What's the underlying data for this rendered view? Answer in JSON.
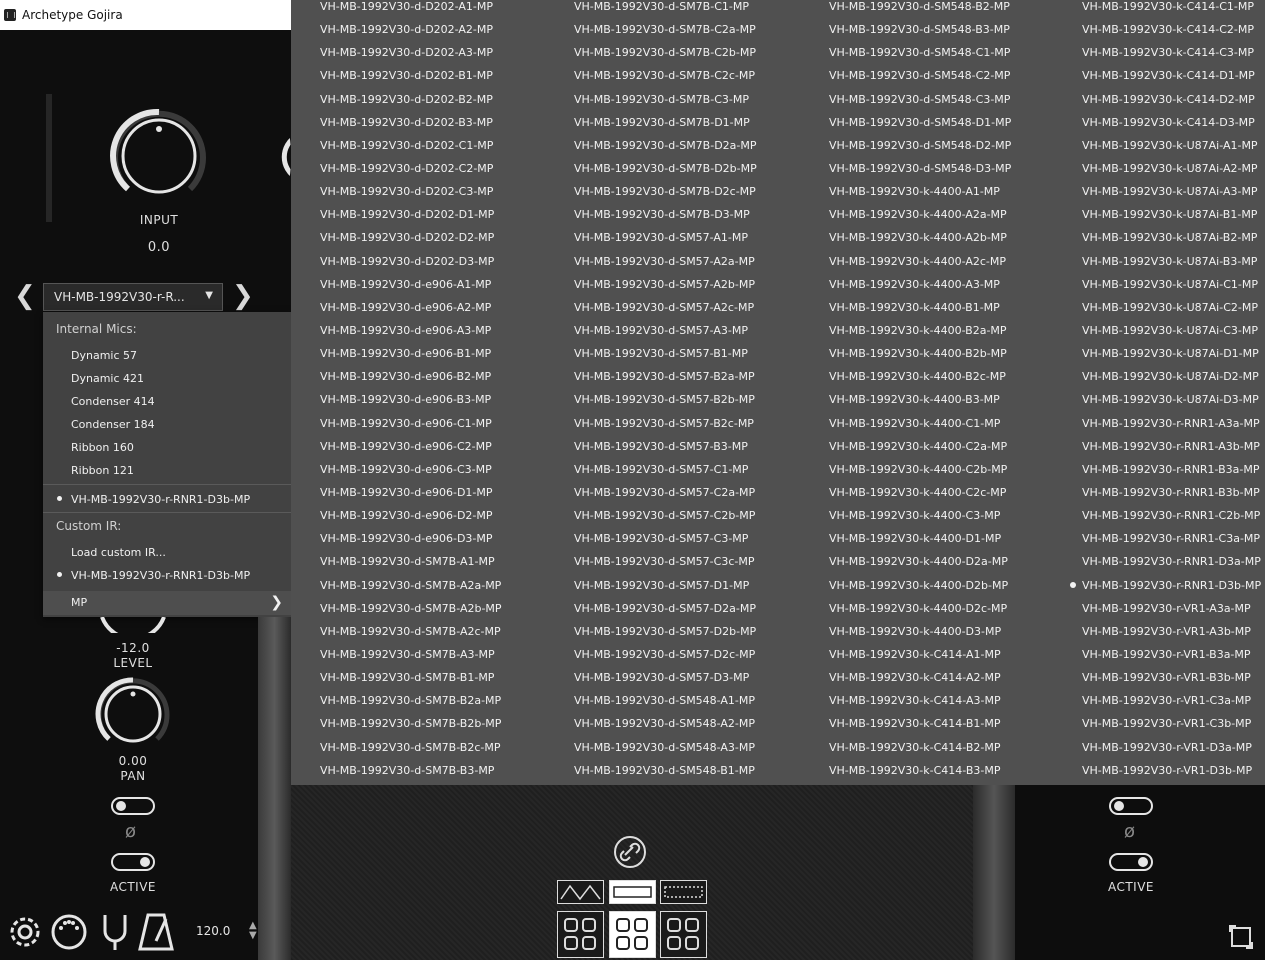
{
  "window": {
    "title": "Archetype Gojira"
  },
  "input": {
    "label": "INPUT",
    "value": "0.0"
  },
  "preset": {
    "current": "VH-MB-1992V30-r-R..."
  },
  "menu": {
    "internal_header": "Internal Mics:",
    "internal_items": [
      "Dynamic 57",
      "Dynamic 421",
      "Condenser 414",
      "Condenser 184",
      "Ribbon 160",
      "Ribbon 121"
    ],
    "selected_internal": "VH-MB-1992V30-r-RNR1-D3b-MP",
    "custom_header": "Custom IR:",
    "load_custom": "Load custom IR...",
    "selected_custom": "VH-MB-1992V30-r-RNR1-D3b-MP",
    "mp_label": "MP"
  },
  "mic": {
    "level_value": "-12.0",
    "level_label": "LEVEL",
    "pan_value": "0.00",
    "pan_label": "PAN",
    "active_label": "ACTIVE",
    "right_active_label": "ACTIVE"
  },
  "phase_symbol": "ø",
  "tempo": {
    "value": "120.0"
  },
  "submenu": {
    "selected": "VH-MB-1992V30-r-RNR1-D3b-MP",
    "columns": [
      [
        "VH-MB-1992V30-d-D202-A1-MP",
        "VH-MB-1992V30-d-D202-A2-MP",
        "VH-MB-1992V30-d-D202-A3-MP",
        "VH-MB-1992V30-d-D202-B1-MP",
        "VH-MB-1992V30-d-D202-B2-MP",
        "VH-MB-1992V30-d-D202-B3-MP",
        "VH-MB-1992V30-d-D202-C1-MP",
        "VH-MB-1992V30-d-D202-C2-MP",
        "VH-MB-1992V30-d-D202-C3-MP",
        "VH-MB-1992V30-d-D202-D1-MP",
        "VH-MB-1992V30-d-D202-D2-MP",
        "VH-MB-1992V30-d-D202-D3-MP",
        "VH-MB-1992V30-d-e906-A1-MP",
        "VH-MB-1992V30-d-e906-A2-MP",
        "VH-MB-1992V30-d-e906-A3-MP",
        "VH-MB-1992V30-d-e906-B1-MP",
        "VH-MB-1992V30-d-e906-B2-MP",
        "VH-MB-1992V30-d-e906-B3-MP",
        "VH-MB-1992V30-d-e906-C1-MP",
        "VH-MB-1992V30-d-e906-C2-MP",
        "VH-MB-1992V30-d-e906-C3-MP",
        "VH-MB-1992V30-d-e906-D1-MP",
        "VH-MB-1992V30-d-e906-D2-MP",
        "VH-MB-1992V30-d-e906-D3-MP",
        "VH-MB-1992V30-d-SM7B-A1-MP",
        "VH-MB-1992V30-d-SM7B-A2a-MP",
        "VH-MB-1992V30-d-SM7B-A2b-MP",
        "VH-MB-1992V30-d-SM7B-A2c-MP",
        "VH-MB-1992V30-d-SM7B-A3-MP",
        "VH-MB-1992V30-d-SM7B-B1-MP",
        "VH-MB-1992V30-d-SM7B-B2a-MP",
        "VH-MB-1992V30-d-SM7B-B2b-MP",
        "VH-MB-1992V30-d-SM7B-B2c-MP",
        "VH-MB-1992V30-d-SM7B-B3-MP"
      ],
      [
        "VH-MB-1992V30-d-SM7B-C1-MP",
        "VH-MB-1992V30-d-SM7B-C2a-MP",
        "VH-MB-1992V30-d-SM7B-C2b-MP",
        "VH-MB-1992V30-d-SM7B-C2c-MP",
        "VH-MB-1992V30-d-SM7B-C3-MP",
        "VH-MB-1992V30-d-SM7B-D1-MP",
        "VH-MB-1992V30-d-SM7B-D2a-MP",
        "VH-MB-1992V30-d-SM7B-D2b-MP",
        "VH-MB-1992V30-d-SM7B-D2c-MP",
        "VH-MB-1992V30-d-SM7B-D3-MP",
        "VH-MB-1992V30-d-SM57-A1-MP",
        "VH-MB-1992V30-d-SM57-A2a-MP",
        "VH-MB-1992V30-d-SM57-A2b-MP",
        "VH-MB-1992V30-d-SM57-A2c-MP",
        "VH-MB-1992V30-d-SM57-A3-MP",
        "VH-MB-1992V30-d-SM57-B1-MP",
        "VH-MB-1992V30-d-SM57-B2a-MP",
        "VH-MB-1992V30-d-SM57-B2b-MP",
        "VH-MB-1992V30-d-SM57-B2c-MP",
        "VH-MB-1992V30-d-SM57-B3-MP",
        "VH-MB-1992V30-d-SM57-C1-MP",
        "VH-MB-1992V30-d-SM57-C2a-MP",
        "VH-MB-1992V30-d-SM57-C2b-MP",
        "VH-MB-1992V30-d-SM57-C3-MP",
        "VH-MB-1992V30-d-SM57-C3c-MP",
        "VH-MB-1992V30-d-SM57-D1-MP",
        "VH-MB-1992V30-d-SM57-D2a-MP",
        "VH-MB-1992V30-d-SM57-D2b-MP",
        "VH-MB-1992V30-d-SM57-D2c-MP",
        "VH-MB-1992V30-d-SM57-D3-MP",
        "VH-MB-1992V30-d-SM548-A1-MP",
        "VH-MB-1992V30-d-SM548-A2-MP",
        "VH-MB-1992V30-d-SM548-A3-MP",
        "VH-MB-1992V30-d-SM548-B1-MP"
      ],
      [
        "VH-MB-1992V30-d-SM548-B2-MP",
        "VH-MB-1992V30-d-SM548-B3-MP",
        "VH-MB-1992V30-d-SM548-C1-MP",
        "VH-MB-1992V30-d-SM548-C2-MP",
        "VH-MB-1992V30-d-SM548-C3-MP",
        "VH-MB-1992V30-d-SM548-D1-MP",
        "VH-MB-1992V30-d-SM548-D2-MP",
        "VH-MB-1992V30-d-SM548-D3-MP",
        "VH-MB-1992V30-k-4400-A1-MP",
        "VH-MB-1992V30-k-4400-A2a-MP",
        "VH-MB-1992V30-k-4400-A2b-MP",
        "VH-MB-1992V30-k-4400-A2c-MP",
        "VH-MB-1992V30-k-4400-A3-MP",
        "VH-MB-1992V30-k-4400-B1-MP",
        "VH-MB-1992V30-k-4400-B2a-MP",
        "VH-MB-1992V30-k-4400-B2b-MP",
        "VH-MB-1992V30-k-4400-B2c-MP",
        "VH-MB-1992V30-k-4400-B3-MP",
        "VH-MB-1992V30-k-4400-C1-MP",
        "VH-MB-1992V30-k-4400-C2a-MP",
        "VH-MB-1992V30-k-4400-C2b-MP",
        "VH-MB-1992V30-k-4400-C2c-MP",
        "VH-MB-1992V30-k-4400-C3-MP",
        "VH-MB-1992V30-k-4400-D1-MP",
        "VH-MB-1992V30-k-4400-D2a-MP",
        "VH-MB-1992V30-k-4400-D2b-MP",
        "VH-MB-1992V30-k-4400-D2c-MP",
        "VH-MB-1992V30-k-4400-D3-MP",
        "VH-MB-1992V30-k-C414-A1-MP",
        "VH-MB-1992V30-k-C414-A2-MP",
        "VH-MB-1992V30-k-C414-A3-MP",
        "VH-MB-1992V30-k-C414-B1-MP",
        "VH-MB-1992V30-k-C414-B2-MP",
        "VH-MB-1992V30-k-C414-B3-MP"
      ],
      [
        "VH-MB-1992V30-k-C414-C1-MP",
        "VH-MB-1992V30-k-C414-C2-MP",
        "VH-MB-1992V30-k-C414-C3-MP",
        "VH-MB-1992V30-k-C414-D1-MP",
        "VH-MB-1992V30-k-C414-D2-MP",
        "VH-MB-1992V30-k-C414-D3-MP",
        "VH-MB-1992V30-k-U87Ai-A1-MP",
        "VH-MB-1992V30-k-U87Ai-A2-MP",
        "VH-MB-1992V30-k-U87Ai-A3-MP",
        "VH-MB-1992V30-k-U87Ai-B1-MP",
        "VH-MB-1992V30-k-U87Ai-B2-MP",
        "VH-MB-1992V30-k-U87Ai-B3-MP",
        "VH-MB-1992V30-k-U87Ai-C1-MP",
        "VH-MB-1992V30-k-U87Ai-C2-MP",
        "VH-MB-1992V30-k-U87Ai-C3-MP",
        "VH-MB-1992V30-k-U87Ai-D1-MP",
        "VH-MB-1992V30-k-U87Ai-D2-MP",
        "VH-MB-1992V30-k-U87Ai-D3-MP",
        "VH-MB-1992V30-r-RNR1-A3a-MP",
        "VH-MB-1992V30-r-RNR1-A3b-MP",
        "VH-MB-1992V30-r-RNR1-B3a-MP",
        "VH-MB-1992V30-r-RNR1-B3b-MP",
        "VH-MB-1992V30-r-RNR1-C2b-MP",
        "VH-MB-1992V30-r-RNR1-C3a-MP",
        "VH-MB-1992V30-r-RNR1-D3a-MP",
        "VH-MB-1992V30-r-RNR1-D3b-MP",
        "VH-MB-1992V30-r-VR1-A3a-MP",
        "VH-MB-1992V30-r-VR1-A3b-MP",
        "VH-MB-1992V30-r-VR1-B3a-MP",
        "VH-MB-1992V30-r-VR1-B3b-MP",
        "VH-MB-1992V30-r-VR1-C3a-MP",
        "VH-MB-1992V30-r-VR1-C3b-MP",
        "VH-MB-1992V30-r-VR1-D3a-MP",
        "VH-MB-1992V30-r-VR1-D3b-MP"
      ]
    ]
  }
}
